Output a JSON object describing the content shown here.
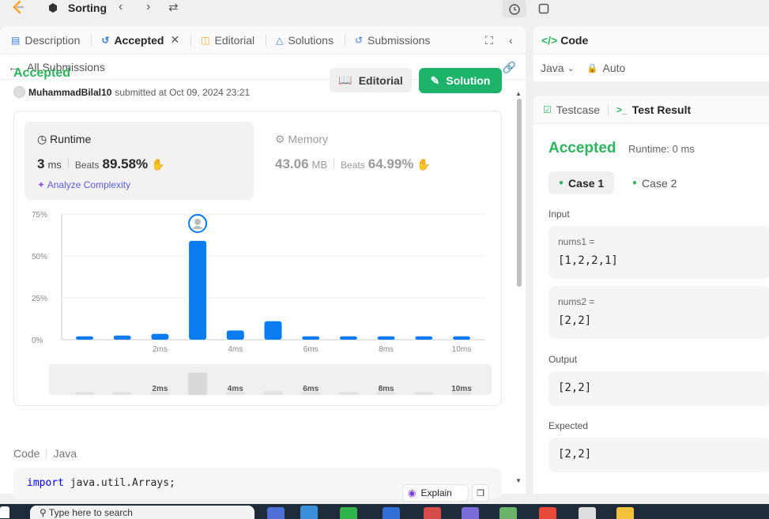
{
  "topbar": {
    "problem_title": "Sorting"
  },
  "left_tabs": [
    {
      "label": "Description"
    },
    {
      "label": "Accepted"
    },
    {
      "label": "Editorial"
    },
    {
      "label": "Solutions"
    },
    {
      "label": "Submissions"
    }
  ],
  "subheader": {
    "back_label": "All Submissions"
  },
  "submission": {
    "status": "Accepted",
    "username": "MuhammadBilal10",
    "submitted_text": "submitted at Oct 09, 2024 23:21",
    "editorial_button": "Editorial",
    "solution_button": "Solution"
  },
  "runtime": {
    "label": "Runtime",
    "value": "3",
    "unit": "ms",
    "beats_label": "Beats",
    "beats_pct": "89.58%",
    "analyze_label": "Analyze Complexity"
  },
  "memory": {
    "label": "Memory",
    "value": "43.06",
    "unit": "MB",
    "beats_label": "Beats",
    "beats_pct": "64.99%"
  },
  "chart_data": {
    "type": "bar",
    "y_ticks": [
      "0%",
      "25%",
      "50%",
      "75%"
    ],
    "ylim": [
      0,
      75
    ],
    "x_tick_labels": [
      "2ms",
      "4ms",
      "6ms",
      "8ms",
      "10ms"
    ],
    "values": [
      2,
      2.5,
      3.5,
      59,
      5.5,
      11,
      2,
      2,
      2,
      2,
      2
    ],
    "highlight_index": 3,
    "minimap_tick_labels": [
      "2ms",
      "4ms",
      "6ms",
      "8ms",
      "10ms"
    ]
  },
  "code_section": {
    "label": "Code",
    "language": "Java",
    "first_line_kw": "import",
    "first_line_rest": " java.util.Arrays;",
    "explain_label": "Explain"
  },
  "code_panel": {
    "title": "Code",
    "language": "Java",
    "auto_label": "Auto"
  },
  "result_panel": {
    "tabs": [
      {
        "label": "Testcase"
      },
      {
        "label": "Test Result"
      }
    ],
    "status": "Accepted",
    "runtime_text": "Runtime: 0 ms",
    "cases": [
      {
        "label": "Case 1"
      },
      {
        "label": "Case 2"
      }
    ],
    "input_label": "Input",
    "nums1_key": "nums1 =",
    "nums1_val": "[1,2,2,1]",
    "nums2_key": "nums2 =",
    "nums2_val": "[2,2]",
    "output_label": "Output",
    "output_val": "[2,2]",
    "expected_label": "Expected",
    "expected_val": "[2,2]"
  },
  "taskbar": {
    "search_text": "Type here to search"
  },
  "colors": {
    "accent_green": "#2db55d",
    "bar_blue": "#0a7cf0",
    "solution_green": "#1db36a"
  }
}
